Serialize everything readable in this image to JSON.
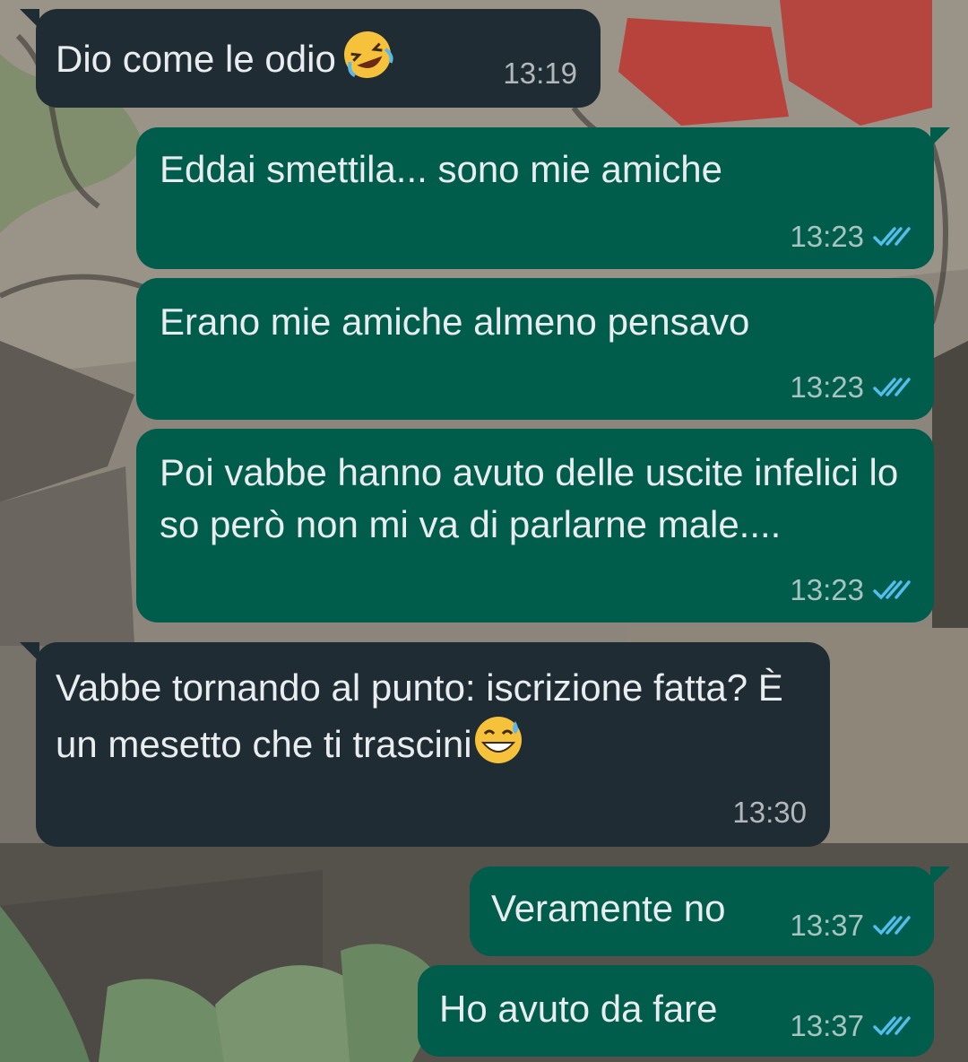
{
  "theme": {
    "incoming_bubble_color": "#202c33",
    "outgoing_bubble_color": "#005c4b",
    "text_color": "#e9edef",
    "read_tick_color": "#53bdeb"
  },
  "messages": [
    {
      "direction": "incoming",
      "text": "Dio come le odio",
      "emoji": "rolling-on-floor-laughing-emoji",
      "time": "13:19"
    },
    {
      "direction": "outgoing",
      "text": "Eddai smettila... sono mie amiche",
      "time": "13:23",
      "status": "read-double-check-icon"
    },
    {
      "direction": "outgoing",
      "text": "Erano mie amiche almeno pensavo",
      "time": "13:23",
      "status": "read-double-check-icon"
    },
    {
      "direction": "outgoing",
      "text": "Poi vabbe hanno avuto delle uscite infelici lo so però non mi va di parlarne male....",
      "time": "13:23",
      "status": "read-double-check-icon"
    },
    {
      "direction": "incoming",
      "text": "Vabbe tornando al punto: iscrizione fatta? È un mesetto che ti trascini",
      "emoji": "grinning-face-with-sweat-emoji",
      "time": "13:30"
    },
    {
      "direction": "outgoing",
      "text": "Veramente no",
      "time": "13:37",
      "status": "read-double-check-icon"
    },
    {
      "direction": "outgoing",
      "text": "Ho avuto da fare",
      "time": "13:37",
      "status": "read-double-check-icon"
    }
  ]
}
